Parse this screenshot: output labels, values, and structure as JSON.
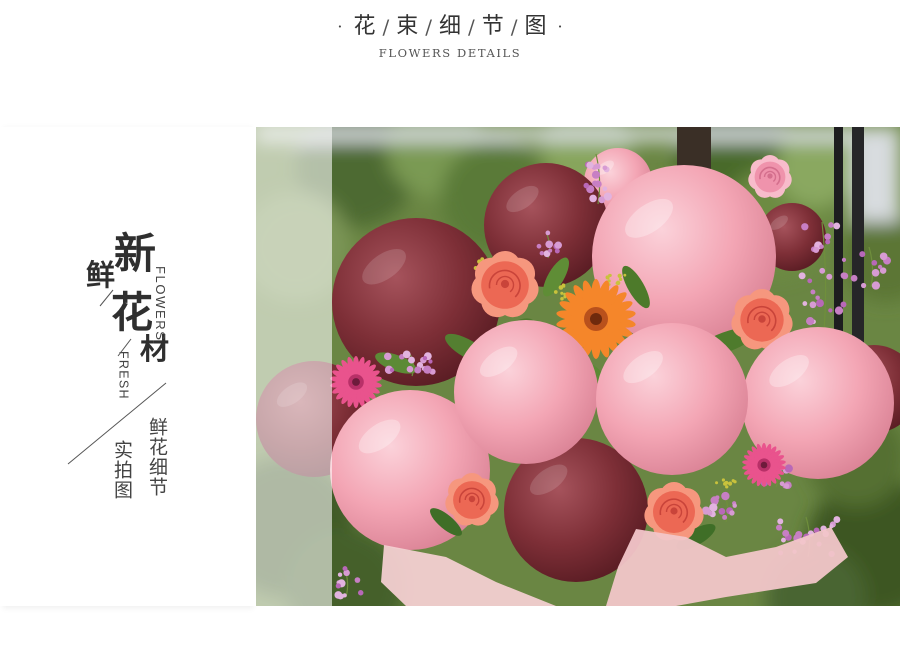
{
  "header": {
    "bullet": "·",
    "separator": "/",
    "title_chars": [
      "花",
      "束",
      "细",
      "节",
      "图"
    ],
    "subtitle": "FLOWERS DETAILS"
  },
  "feature_text": {
    "xin": "新",
    "xian": "鲜",
    "hua": "花",
    "cai": "材",
    "flowers_en": "FLOWERS",
    "fresh_en": "FRESH",
    "caption_detail": "鲜花细节",
    "caption_photo": "实拍图"
  },
  "colors": {
    "text": "#333333",
    "balloon_pink": "#f3a5b4",
    "balloon_burgundy": "#7e2f37",
    "rose_coral": "#ec6854",
    "gerbera_orange": "#f5862a",
    "statice_lilac": "#c77fc4"
  }
}
